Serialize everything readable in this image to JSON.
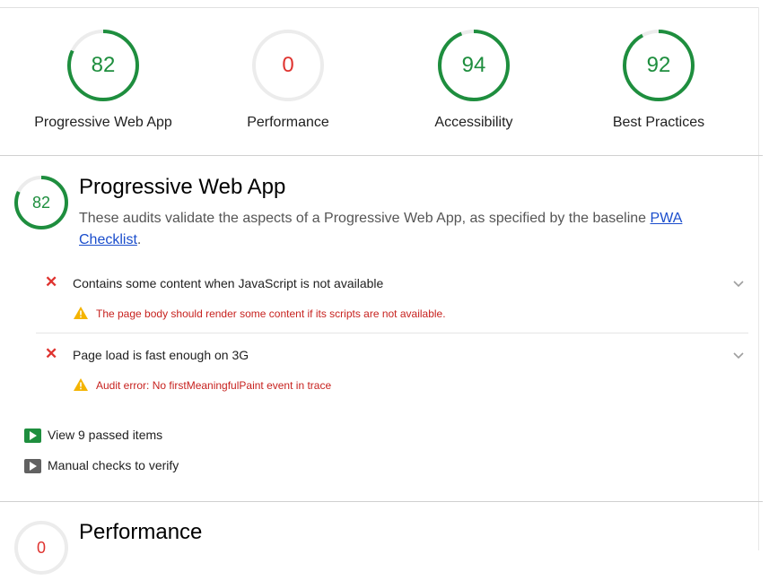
{
  "summary": {
    "gauges": [
      {
        "score": "82",
        "label": "Progressive Web App",
        "value": 0.82,
        "color": "#1e8e3e"
      },
      {
        "score": "0",
        "label": "Performance",
        "value": 0.0,
        "color": "#df332f"
      },
      {
        "score": "94",
        "label": "Accessibility",
        "value": 0.94,
        "color": "#1e8e3e"
      },
      {
        "score": "92",
        "label": "Best Practices",
        "value": 0.92,
        "color": "#1e8e3e"
      }
    ]
  },
  "pwa": {
    "score": "82",
    "score_value": 0.82,
    "title": "Progressive Web App",
    "description": "These audits validate the aspects of a Progressive Web App, as specified by the baseline ",
    "link_text_1": "PWA",
    "link_text_2": "Checklist",
    "description_end": ".",
    "audits": [
      {
        "title": "Contains some content when JavaScript is not available",
        "warning": "The page body should render some content if its scripts are not available."
      },
      {
        "title": "Page load is fast enough on 3G",
        "warning": "Audit error: No firstMeaningfulPaint event in trace"
      }
    ],
    "passed_label": "View 9 passed items",
    "manual_label": "Manual checks to verify"
  },
  "performance": {
    "score": "0",
    "title": "Performance"
  },
  "colors": {
    "pass": "#1e8e3e",
    "fail": "#df332f",
    "warn": "#f4b400",
    "track": "#ececec"
  }
}
